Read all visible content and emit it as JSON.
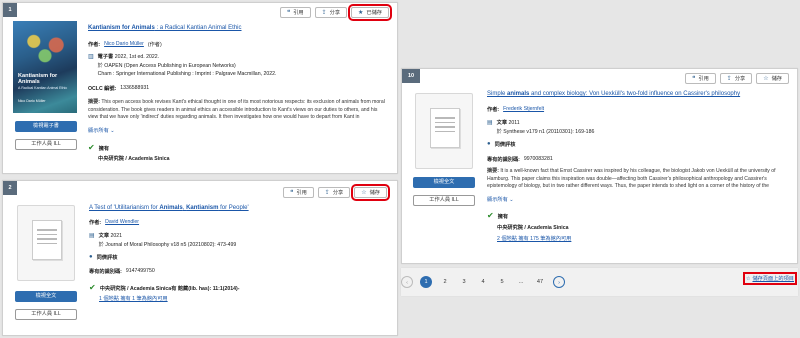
{
  "actions": {
    "cite": "引用",
    "share": "分享",
    "saved": "已儲存",
    "save": "儲存"
  },
  "results": [
    {
      "number": "1",
      "title_parts": [
        "Kantianism for Animals",
        " : a Radical Kantian Animal Ethic"
      ],
      "author_label": "作者:",
      "author": "Nico Dario Müller",
      "author_role": "(作者)",
      "type_label": "電子書",
      "type_detail": "2022, 1st ed. 2022.",
      "series": "於 OAPEN (Open Access Publishing in European Networks)",
      "publisher": "Cham : Springer International Publishing : Imprint : Palgrave Macmillan, 2022.",
      "oclc_label": "OCLC 編號:",
      "oclc": "1336588931",
      "abstract_label": "摘要:",
      "abstract": "This open access book revises Kant's ethical thought in one of its most notorious respects: its exclusion of animals from moral consideration. The book gives readers in animal ethics an accessible introduction to Kant's views on our duties to others, and his view that we have only 'indirect' duties regarding animals. It then investigates how one would have to depart from Kant in",
      "show_more": "顯示所有",
      "holdings_label": "擁有",
      "library": "中央研究院 / Academia Sinica",
      "primary_button": "檢視電子書",
      "secondary_button": "工作人員 ILL",
      "cover_title": "Kantianism for Animals",
      "cover_subtitle": "A Radical Kantian Animal Ethic",
      "cover_author": "Nico Dario Müller"
    },
    {
      "number": "2",
      "title_parts": [
        "A Test of 'Utilitarianism for ",
        "Animals",
        ", ",
        "Kantianism",
        " for People'"
      ],
      "author_label": "作者:",
      "author": "David Wendler",
      "type_label": "文章",
      "type_detail": "2021",
      "source": "於 Journal of Moral Philosophy  v18 n5 (20210802): 473-499",
      "peer": "同儕評核",
      "id_label": "專有的識別碼:",
      "id": "9147499750",
      "holdings_label": "中央研究院 / Academia Sinica有 館藏(lib. has): 11:1(2014)-",
      "holdings_link": "1 個地點 擁有 1 筆為館內可用",
      "primary_button": "檢視全文",
      "secondary_button": "工作人員 ILL"
    },
    {
      "number": "10",
      "title_parts": [
        "Simple ",
        "animals",
        " and complex biology: Von Uexküll's two-fold influence on Cassirer's philosophy"
      ],
      "author_label": "作者:",
      "author": "Frederik Stjernfelt",
      "type_label": "文章",
      "type_detail": "2011",
      "source": "於 Synthese  v179 n1 (20110301): 169-186",
      "peer": "同儕評核",
      "id_label": "專有的識別碼:",
      "id": "9970083281",
      "abstract_label": "摘要:",
      "abstract": "It is a well-known fact that Ernst Cassirer was inspired by his colleague, the biologist Jakob von Uexküll at the university of Hamburg. This paper claims this inspiration was double—affecting both Cassirer's philosophical anthropology and Cassirer's epistemology of biology, but in two rather different ways. Thus, the paper intends to shed light on a corner of the history of the",
      "show_more": "顯示所有",
      "holdings_label": "擁有",
      "library": "中央研究院 / Academia Sinica",
      "holdings_link": "2 個地點 擁有 175 筆為館內可用",
      "primary_button": "檢視全文",
      "secondary_button": "工作人員 ILL"
    }
  ],
  "pagination": {
    "pages": [
      "1",
      "2",
      "3",
      "4",
      "5",
      "...",
      "47"
    ],
    "current": "1",
    "prev": "‹",
    "next": "›"
  },
  "save_query": "儲存頁面上的項目"
}
